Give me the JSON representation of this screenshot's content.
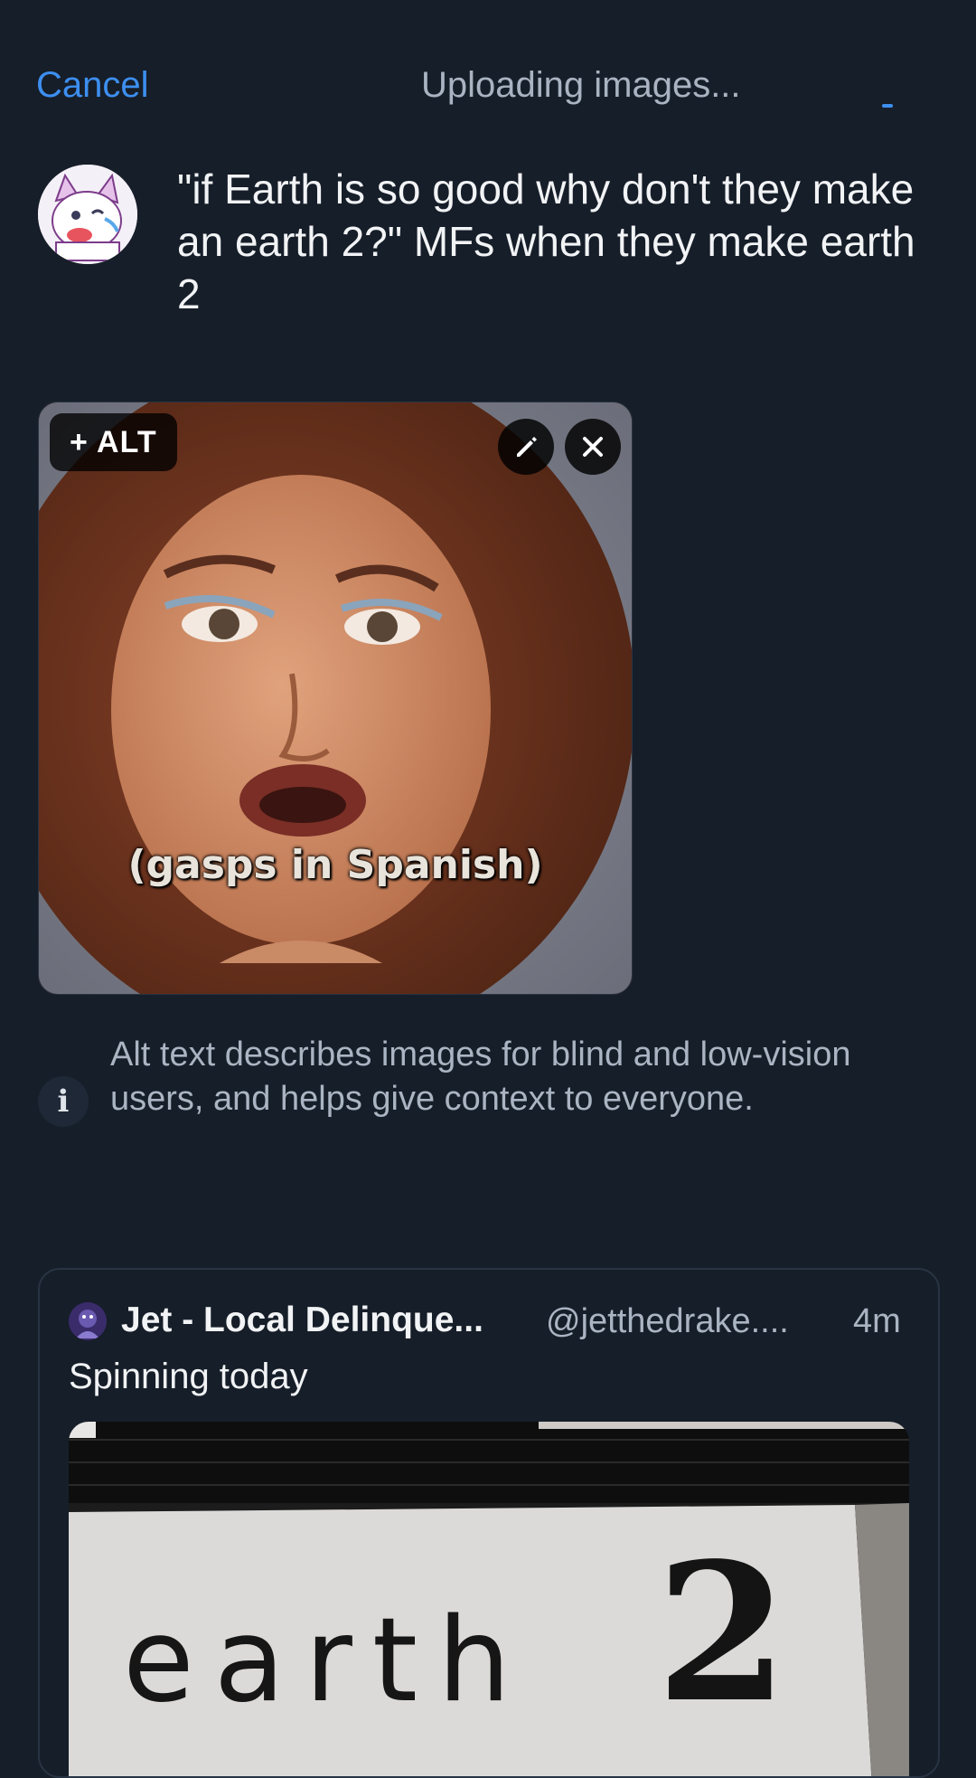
{
  "header": {
    "cancel_label": "Cancel",
    "status_title": "Uploading images..."
  },
  "composer": {
    "post_text": "\"if Earth is so good why don't they make an earth 2?\" MFs when they make earth 2",
    "avatar_icon": "user-avatar"
  },
  "attachment": {
    "alt_label": "+ ALT",
    "caption": "(gasps in Spanish)",
    "edit_icon": "pencil-icon",
    "remove_icon": "close-icon"
  },
  "alt_info": {
    "icon": "info-icon",
    "icon_glyph": "i",
    "text": "Alt text describes images for blind and low-vision users, and helps give context to everyone."
  },
  "quote": {
    "author_name": "Jet - Local Delinque...",
    "handle": "@jetthedrake....",
    "time": "4m",
    "text": "Spinning today",
    "sign_word": "earth",
    "sign_number": "2"
  },
  "colors": {
    "background": "#161e29",
    "accent": "#3d8ff0",
    "muted_text": "#aab4c2"
  }
}
